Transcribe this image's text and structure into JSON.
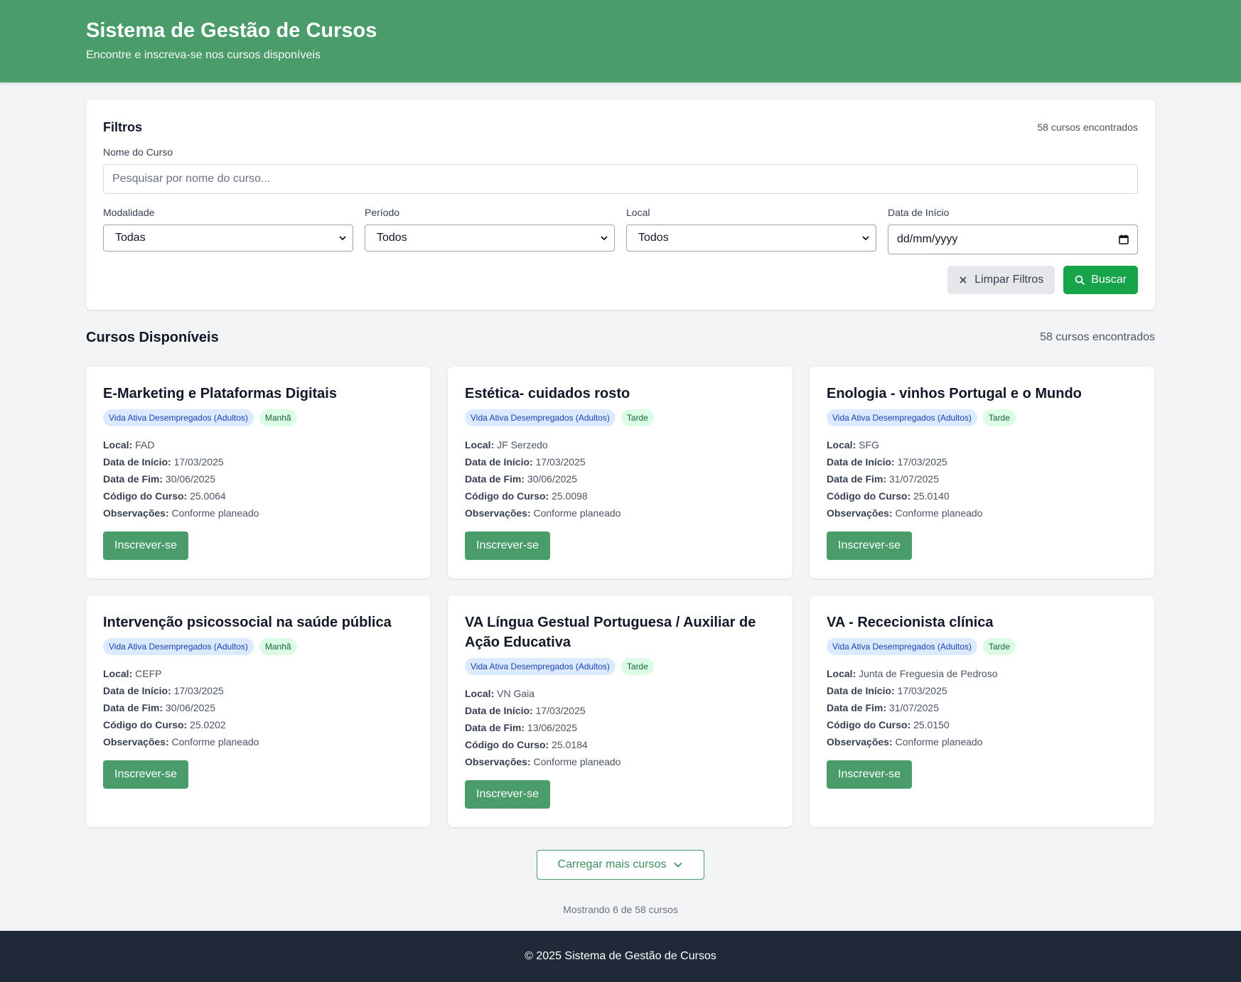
{
  "header": {
    "title": "Sistema de Gestão de Cursos",
    "subtitle": "Encontre e inscreva-se nos cursos disponíveis"
  },
  "filters": {
    "title": "Filtros",
    "count": "58 cursos encontrados",
    "name_label": "Nome do Curso",
    "name_placeholder": "Pesquisar por nome do curso...",
    "modalidade_label": "Modalidade",
    "modalidade_value": "Todas",
    "periodo_label": "Período",
    "periodo_value": "Todos",
    "local_label": "Local",
    "local_value": "Todos",
    "date_label": "Data de Início",
    "date_value": "dd/mm/yyyy",
    "clear_label": "Limpar Filtros",
    "search_label": "Buscar"
  },
  "list": {
    "title": "Cursos Disponíveis",
    "count": "58 cursos encontrados"
  },
  "field_labels": {
    "local": "Local:",
    "start": "Data de Início:",
    "end": "Data de Fim:",
    "code": "Código do Curso:",
    "notes": "Observações:"
  },
  "enroll_label": "Inscrever-se",
  "courses": [
    {
      "title": "E-Marketing e Plataformas Digitais",
      "modalidade": "Vida Ativa Desempregados (Adultos)",
      "periodo": "Manhã",
      "local": "FAD",
      "start": "17/03/2025",
      "end": "30/06/2025",
      "code": "25.0064",
      "notes": "Conforme planeado"
    },
    {
      "title": "Estética- cuidados rosto",
      "modalidade": "Vida Ativa Desempregados (Adultos)",
      "periodo": "Tarde",
      "local": "JF Serzedo",
      "start": "17/03/2025",
      "end": "30/06/2025",
      "code": "25.0098",
      "notes": "Conforme planeado"
    },
    {
      "title": "Enologia - vinhos Portugal e o Mundo",
      "modalidade": "Vida Ativa Desempregados (Adultos)",
      "periodo": "Tarde",
      "local": "SFG",
      "start": "17/03/2025",
      "end": "31/07/2025",
      "code": "25.0140",
      "notes": "Conforme planeado"
    },
    {
      "title": "Intervenção psicossocial na saúde pública",
      "modalidade": "Vida Ativa Desempregados (Adultos)",
      "periodo": "Manhã",
      "local": "CEFP",
      "start": "17/03/2025",
      "end": "30/06/2025",
      "code": "25.0202",
      "notes": "Conforme planeado"
    },
    {
      "title": "VA Língua Gestual Portuguesa / Auxiliar de Ação Educativa",
      "modalidade": "Vida Ativa Desempregados (Adultos)",
      "periodo": "Tarde",
      "local": "VN Gaia",
      "start": "17/03/2025",
      "end": "13/06/2025",
      "code": "25.0184",
      "notes": "Conforme planeado"
    },
    {
      "title": "VA - Rececionista clínica",
      "modalidade": "Vida Ativa Desempregados (Adultos)",
      "periodo": "Tarde",
      "local": "Junta de Freguesia de Pedroso",
      "start": "17/03/2025",
      "end": "31/07/2025",
      "code": "25.0150",
      "notes": "Conforme planeado"
    }
  ],
  "load_more_label": "Carregar mais cursos",
  "showing": "Mostrando 6 de 58 cursos",
  "footer": "© 2025 Sistema de Gestão de Cursos",
  "colors": {
    "brand": "#4a9d6b",
    "search_button": "#16a34a",
    "footer_bg": "#1f2937"
  }
}
